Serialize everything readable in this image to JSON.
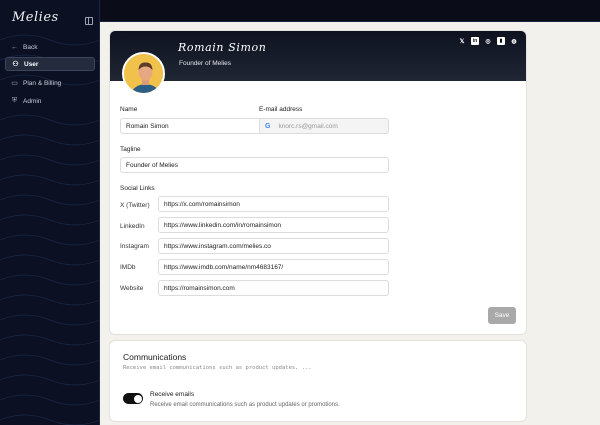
{
  "app": {
    "logo": "Melies"
  },
  "sidebar": {
    "items": [
      {
        "label": "Back",
        "icon": "arrow-left-icon",
        "glyph": "←"
      },
      {
        "label": "User",
        "icon": "user-icon",
        "glyph": "⚇"
      },
      {
        "label": "Plan & Billing",
        "icon": "card-icon",
        "glyph": "▭"
      },
      {
        "label": "Admin",
        "icon": "shield-icon",
        "glyph": "⛨"
      }
    ],
    "active_item": "User"
  },
  "profile": {
    "name": "Romain Simon",
    "tagline": "Founder of Melies",
    "socials": [
      "x",
      "linkedin",
      "instagram",
      "imdb",
      "website"
    ]
  },
  "form": {
    "name_label": "Name",
    "name_value": "Romain Simon",
    "email_label": "E-mail address",
    "email_value": "knorc.rs@gmail.com",
    "tagline_label": "Tagline",
    "tagline_value": "Founder of Melies",
    "social_links_label": "Social Links",
    "social_links": [
      {
        "label": "X (Twitter)",
        "value": "https://x.com/romainsimon"
      },
      {
        "label": "LinkedIn",
        "value": "https://www.linkedin.com/in/romainsimon"
      },
      {
        "label": "Instagram",
        "value": "https://www.instagram.com/melies.co"
      },
      {
        "label": "IMDb",
        "value": "https://www.imdb.com/name/nm4683167/"
      },
      {
        "label": "Website",
        "value": "https://romainsimon.com"
      }
    ],
    "save_label": "Save"
  },
  "communications": {
    "title": "Communications",
    "subtitle": "Receive email communications such as product updates, ...",
    "toggle_label": "Receive emails",
    "toggle_desc": "Receive email communications such as product updates or promotions.",
    "toggle_on": true
  },
  "colors": {
    "sidebar_bg": "#0b1122",
    "banner_bg": "#0e1220",
    "avatar_bg": "#f0c24c",
    "save_button_bg": "#a9a9a9",
    "page_bg": "#f3f1ec"
  }
}
